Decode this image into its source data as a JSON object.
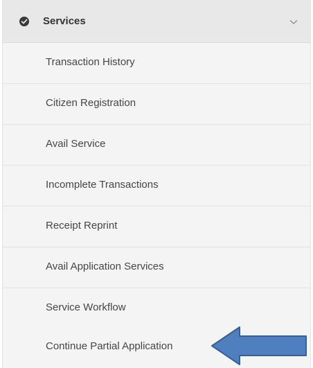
{
  "menu": {
    "header": {
      "label": "Services",
      "icon": "check-circle-icon",
      "toggle_icon": "chevron-down-icon"
    },
    "items": [
      {
        "label": "Transaction History"
      },
      {
        "label": "Citizen Registration"
      },
      {
        "label": "Avail Service"
      },
      {
        "label": "Incomplete Transactions"
      },
      {
        "label": "Receipt Reprint"
      },
      {
        "label": "Avail Application Services"
      },
      {
        "label": "Service Workflow"
      },
      {
        "label": "Continue Partial Application"
      }
    ]
  },
  "annotation": {
    "icon": "left-arrow-icon",
    "color": "#4f7fbf",
    "border_color": "#35608f"
  }
}
